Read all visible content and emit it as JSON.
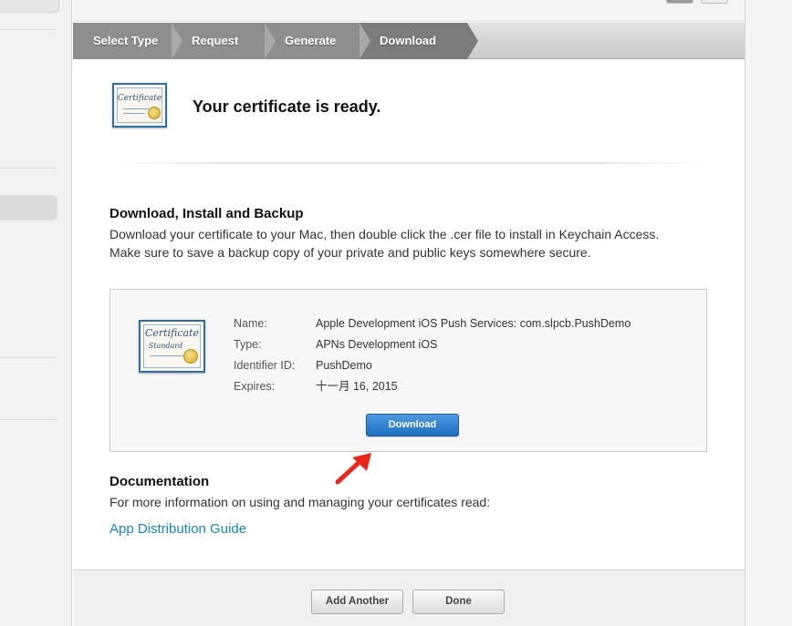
{
  "steps": [
    "Select Type",
    "Request",
    "Generate",
    "Download"
  ],
  "header": {
    "cert_icon_text": "Certificate",
    "title": "Your certificate is ready."
  },
  "download_section": {
    "heading": "Download, Install and Backup",
    "body": "Download your certificate to your Mac, then double click the .cer file to install in Keychain Access. Make sure to save a backup copy of your private and public keys somewhere secure."
  },
  "certificate": {
    "icon_text": "Certificate",
    "icon_subtext": "Standard",
    "fields": [
      {
        "label": "Name:",
        "value": "Apple Development iOS Push Services: com.slpcb.PushDemo"
      },
      {
        "label": "Type:",
        "value": "APNs Development iOS"
      },
      {
        "label": "Identifier ID:",
        "value": "PushDemo"
      },
      {
        "label": "Expires:",
        "value": "十一月 16, 2015"
      }
    ],
    "download_label": "Download"
  },
  "documentation": {
    "heading": "Documentation",
    "body": "For more information on using and managing your certificates read:",
    "link_text": "App Distribution Guide"
  },
  "footer": {
    "add_another_label": "Add Another",
    "done_label": "Done"
  },
  "colors": {
    "accent": "#1a82c8",
    "download_button": "#2b7fd0",
    "annotation_arrow": "#e8271b"
  }
}
